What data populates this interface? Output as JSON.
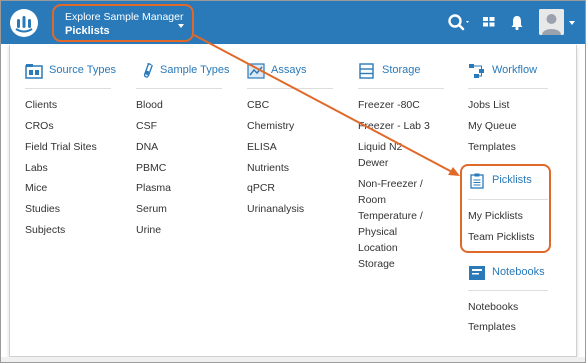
{
  "header": {
    "menu_line1": "Explore Sample Manager",
    "menu_line2": "Picklists",
    "accent_color": "#2a7ab9",
    "highlight_color": "#e0692a"
  },
  "columns": [
    {
      "title": "Source Types",
      "icon": "source-types-icon",
      "items": [
        "Clients",
        "CROs",
        "Field Trial Sites",
        "Labs",
        "Mice",
        "Studies",
        "Subjects"
      ]
    },
    {
      "title": "Sample Types",
      "icon": "test-tube-icon",
      "items": [
        "Blood",
        "CSF",
        "DNA",
        "PBMC",
        "Plasma",
        "Serum",
        "Urine"
      ]
    },
    {
      "title": "Assays",
      "icon": "assay-chart-icon",
      "items": [
        "CBC",
        "Chemistry",
        "ELISA",
        "Nutrients",
        "qPCR",
        "Urinanalysis"
      ]
    },
    {
      "title": "Storage",
      "icon": "storage-icon",
      "items": [
        "Freezer -80C",
        "Freezer - Lab 3",
        "Liquid N2",
        "Dewer",
        "Non-Freezer /",
        "Room",
        "Temperature /",
        "Physical",
        "Location",
        "Storage"
      ]
    },
    {
      "title": "Workflow",
      "icon": "workflow-icon",
      "items": [
        "Jobs List",
        "My Queue",
        "Templates"
      ]
    }
  ],
  "picklists": {
    "title": "Picklists",
    "icon": "picklist-clipboard-icon",
    "items": [
      "My Picklists",
      "Team Picklists"
    ]
  },
  "notebooks": {
    "title": "Notebooks",
    "icon": "notebook-icon",
    "items": [
      "Notebooks",
      "Templates"
    ]
  }
}
